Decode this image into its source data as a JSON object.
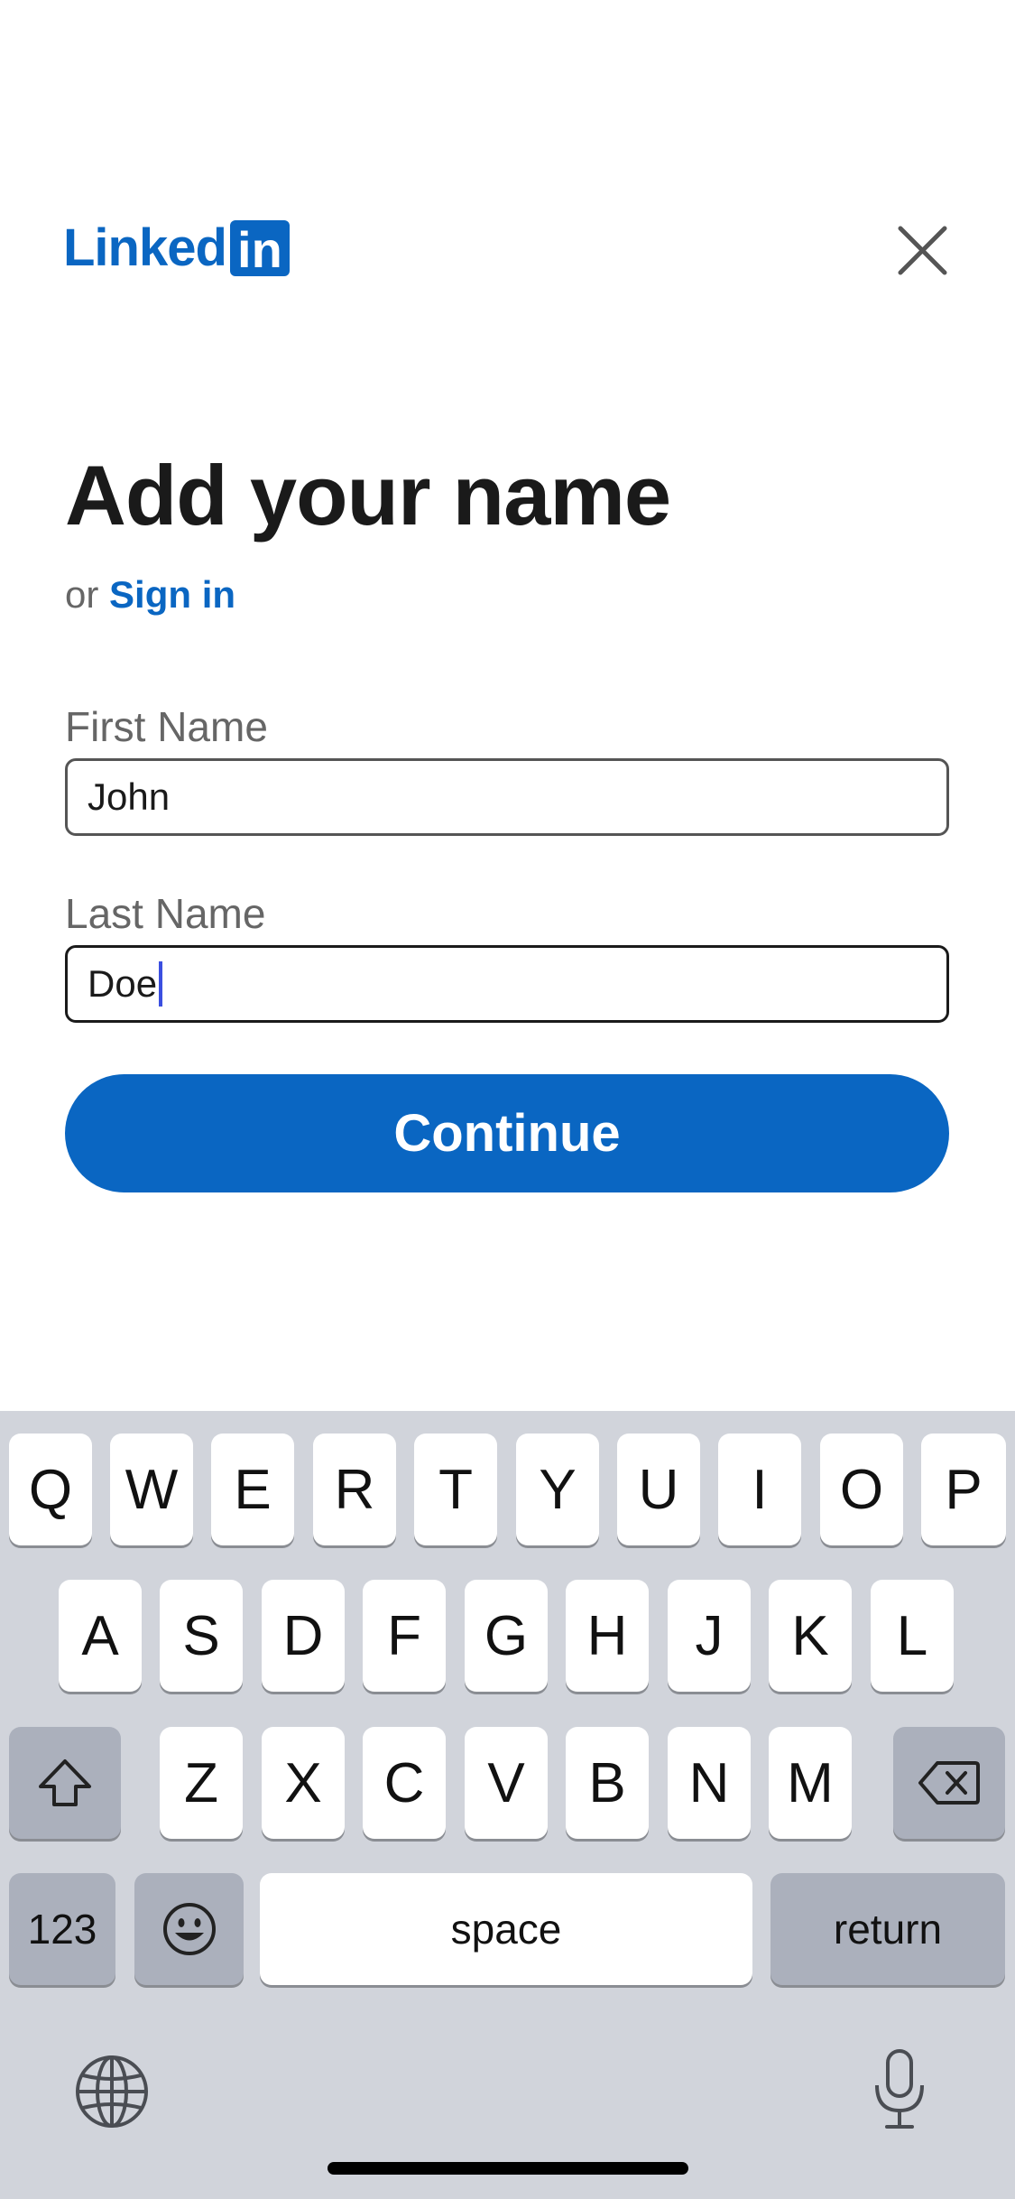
{
  "brand": {
    "word": "Linked",
    "box": "in"
  },
  "header": {
    "close_icon": "close-icon"
  },
  "title": "Add your name",
  "subtitle": {
    "or": "or",
    "sign_in": "Sign in"
  },
  "form": {
    "first_name": {
      "label": "First Name",
      "value": "John"
    },
    "last_name": {
      "label": "Last Name",
      "value": "Doe"
    },
    "continue_label": "Continue"
  },
  "keyboard": {
    "row1": [
      "Q",
      "W",
      "E",
      "R",
      "T",
      "Y",
      "U",
      "I",
      "O",
      "P"
    ],
    "row2": [
      "A",
      "S",
      "D",
      "F",
      "G",
      "H",
      "J",
      "K",
      "L"
    ],
    "row3": [
      "Z",
      "X",
      "C",
      "V",
      "B",
      "N",
      "M"
    ],
    "numbers": "123",
    "space": "space",
    "return": "return",
    "icons": [
      "shift-icon",
      "backspace-icon",
      "emoji-icon",
      "globe-icon",
      "microphone-icon"
    ]
  },
  "colors": {
    "brand_blue": "#0a66c2",
    "caret": "#3b4fe0",
    "keyboard_bg": "#d1d4db"
  }
}
